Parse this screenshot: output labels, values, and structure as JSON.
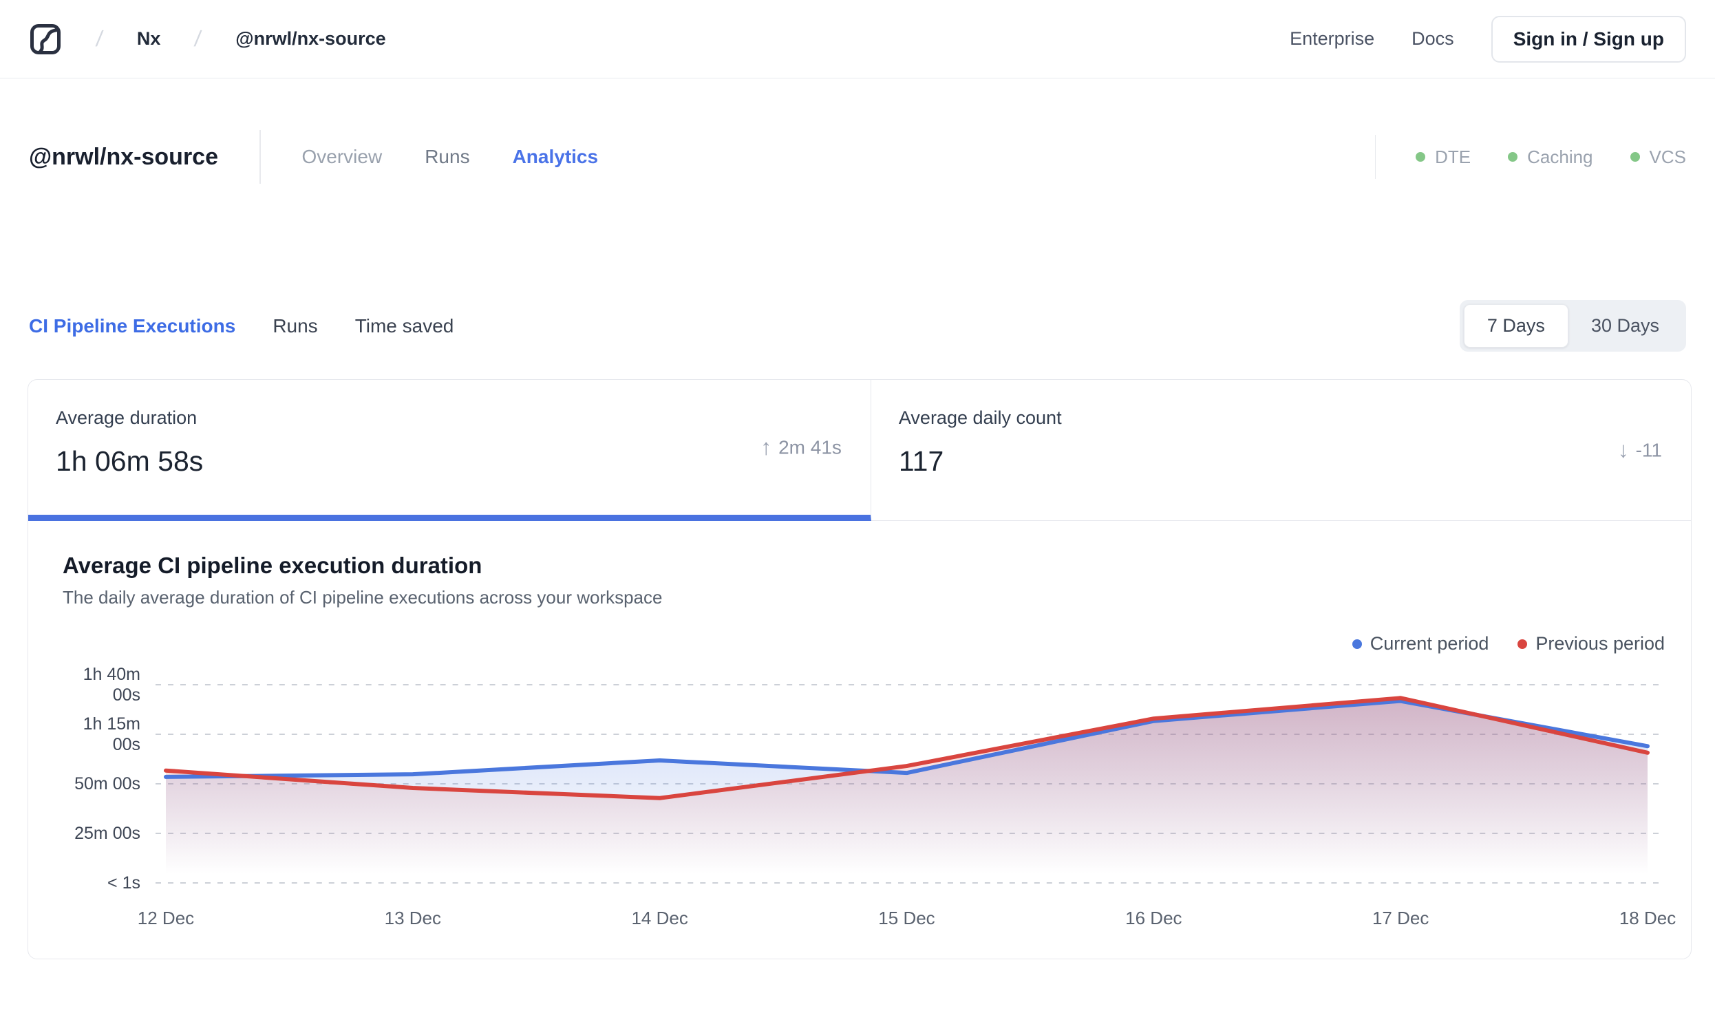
{
  "header": {
    "breadcrumb": {
      "separator": "/",
      "items": [
        "Nx",
        "@nrwl/nx-source"
      ]
    },
    "links": {
      "enterprise": "Enterprise",
      "docs": "Docs"
    },
    "sign_in_label": "Sign in / Sign up"
  },
  "workspace": {
    "title": "@nrwl/nx-source",
    "tabs": [
      {
        "label": "Overview",
        "active": false
      },
      {
        "label": "Runs",
        "active": false
      },
      {
        "label": "Analytics",
        "active": true
      }
    ],
    "status": {
      "dot_color": "#84c787",
      "items": [
        {
          "label": "DTE"
        },
        {
          "label": "Caching"
        },
        {
          "label": "VCS"
        }
      ]
    }
  },
  "analytics": {
    "tabs": [
      {
        "label": "CI Pipeline Executions",
        "active": true
      },
      {
        "label": "Runs",
        "active": false
      },
      {
        "label": "Time saved",
        "active": false
      }
    ],
    "range": {
      "options": [
        {
          "label": "7 Days",
          "selected": true
        },
        {
          "label": "30 Days",
          "selected": false
        }
      ]
    }
  },
  "stats": [
    {
      "label": "Average duration",
      "value": "1h 06m 58s",
      "delta_arrow": "↑",
      "delta": "2m 41s",
      "active": true,
      "accent_color": "#4a72e0"
    },
    {
      "label": "Average daily count",
      "value": "117",
      "delta_arrow": "↓",
      "delta": "-11",
      "active": false
    }
  ],
  "chart_data": {
    "type": "line",
    "title": "Average CI pipeline execution duration",
    "subtitle": "The daily average duration of CI pipeline executions across your workspace",
    "categories": [
      "12 Dec",
      "13 Dec",
      "14 Dec",
      "15 Dec",
      "16 Dec",
      "17 Dec",
      "18 Dec"
    ],
    "unit": "minutes",
    "series": [
      {
        "name": "Current period",
        "color": "#4a77dd",
        "values": [
          53.5,
          54.8,
          61.8,
          55.5,
          81.7,
          91.8,
          69.0
        ],
        "values_display": [
          "53m 30s",
          "54m 48s",
          "1h 01m 48s",
          "55m 30s",
          "1h 21m 42s",
          "1h 31m 48s",
          "1h 09m 00s"
        ]
      },
      {
        "name": "Previous period",
        "color": "#d9453f",
        "values": [
          56.7,
          47.9,
          42.8,
          59.0,
          82.9,
          93.3,
          65.7
        ],
        "values_display": [
          "56m 42s",
          "47m 54s",
          "42m 48s",
          "59m 00s",
          "1h 22m 54s",
          "1h 33m 18s",
          "1h 05m 42s"
        ]
      }
    ],
    "y_ticks": [
      {
        "minutes": 100,
        "label": "1h 40m 00s"
      },
      {
        "minutes": 75,
        "label": "1h 15m 00s"
      },
      {
        "minutes": 50,
        "label": "50m 00s"
      },
      {
        "minutes": 25,
        "label": "25m 00s"
      },
      {
        "minutes": 0,
        "label": "< 1s"
      }
    ],
    "ylim": [
      0,
      110
    ],
    "grid": "dashed-horizontal",
    "legend_position": "top-right"
  }
}
